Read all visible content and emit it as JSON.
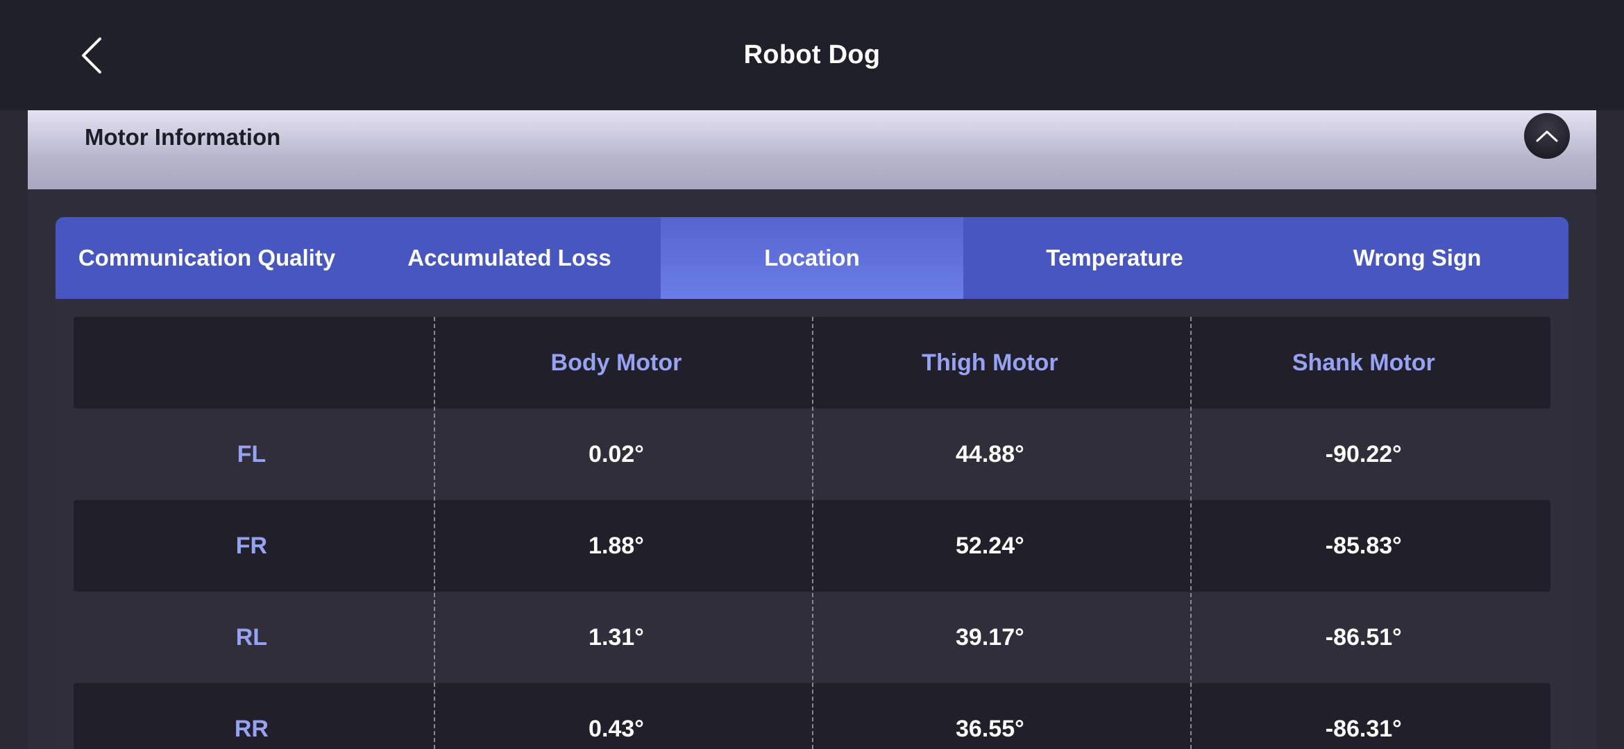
{
  "header": {
    "title": "Robot Dog",
    "back_icon": "chevron-left-icon"
  },
  "section": {
    "title": "Motor Information",
    "collapse_icon": "chevron-up-icon"
  },
  "tabs": [
    {
      "label": "Communication Quality",
      "active": false
    },
    {
      "label": "Accumulated Loss",
      "active": false
    },
    {
      "label": "Location",
      "active": true
    },
    {
      "label": "Temperature",
      "active": false
    },
    {
      "label": "Wrong Sign",
      "active": false
    }
  ],
  "table": {
    "columns": [
      "",
      "Body Motor",
      "Thigh Motor",
      "Shank Motor"
    ],
    "rows": [
      {
        "label": "FL",
        "body": "0.02°",
        "thigh": "44.88°",
        "shank": "-90.22°"
      },
      {
        "label": "FR",
        "body": "1.88°",
        "thigh": "52.24°",
        "shank": "-85.83°"
      },
      {
        "label": "RL",
        "body": "1.31°",
        "thigh": "39.17°",
        "shank": "-86.51°"
      },
      {
        "label": "RR",
        "body": "0.43°",
        "thigh": "36.55°",
        "shank": "-86.31°"
      }
    ]
  },
  "colors": {
    "topbar": "#20202b",
    "tab_bar": "#4757bf",
    "tab_active": "#6b7de6",
    "accent_text": "#97a3f2",
    "row_dark": "#201f2a",
    "row_light": "#2f2e3a"
  }
}
